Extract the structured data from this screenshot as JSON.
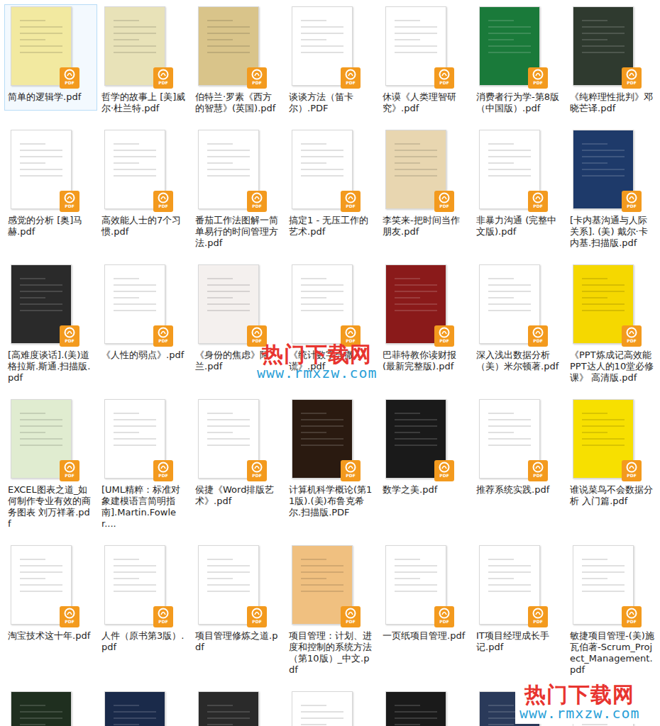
{
  "badge": "PDF",
  "files": [
    {
      "label": "简单的逻辑学.pdf",
      "selected": true,
      "color": "#f2e9a0"
    },
    {
      "label": "哲学的故事上 [美]威尔·杜兰特.pdf",
      "selected": false,
      "color": "#e8e2b8"
    },
    {
      "label": "伯特兰·罗素《西方的智慧》(英国).pdf",
      "selected": false,
      "color": "#d9c48a"
    },
    {
      "label": "谈谈方法（笛卡尔）.PDF",
      "selected": false,
      "color": "#ffffff"
    },
    {
      "label": "休谟《人类理智研究》.pdf",
      "selected": false,
      "color": "#ffffff"
    },
    {
      "label": "消费者行为学-第8版（中国版）.pdf",
      "selected": false,
      "color": "#1a7a3a"
    },
    {
      "label": "《纯粹理性批判》邓晓芒译.pdf",
      "selected": false,
      "color": "#2f3a2f"
    },
    {
      "label": "感觉的分析 [奥]马赫.pdf",
      "selected": false,
      "color": "#ffffff"
    },
    {
      "label": "高效能人士的7个习惯.pdf",
      "selected": false,
      "color": "#ffffff"
    },
    {
      "label": "番茄工作法图解一简单易行的时间管理方法.pdf",
      "selected": false,
      "color": "#ffffff"
    },
    {
      "label": "搞定1 - 无压工作的艺术.pdf",
      "selected": false,
      "color": "#ffffff"
    },
    {
      "label": "李笑来-把时间当作朋友.pdf",
      "selected": false,
      "color": "#e8d6b0"
    },
    {
      "label": "非暴力沟通 (完整中文版).pdf",
      "selected": false,
      "color": "#ffffff"
    },
    {
      "label": "[卡内基沟通与人际关系]. (美) 戴尔·卡内基.扫描版.pdf",
      "selected": false,
      "color": "#1e3a6a"
    },
    {
      "label": "[高难度谈话].(美)道格拉斯.斯通.扫描版.pdf",
      "selected": false,
      "color": "#2a2a2a"
    },
    {
      "label": "《人性的弱点》.pdf",
      "selected": false,
      "color": "#ffffff"
    },
    {
      "label": "《身份的焦虑》阿兰.pdf",
      "selected": false,
      "color": "#f4f0ee"
    },
    {
      "label": "《统计数字会撒谎》.pdf",
      "selected": false,
      "color": "#ffffff"
    },
    {
      "label": "巴菲特教你读财报(最新完整版).pdf",
      "selected": false,
      "color": "#8a1a1a"
    },
    {
      "label": "深入浅出数据分析（美）米尔顿著.pdf",
      "selected": false,
      "color": "#ffffff"
    },
    {
      "label": "《PPT炼成记高效能PPT达人的10堂必修课》 高清版.pdf",
      "selected": false,
      "color": "#f5d800"
    },
    {
      "label": "EXCEL图表之道_如何制作专业有效的商务图表 刘万祥著.pdf",
      "selected": false,
      "color": "#e0ecd0"
    },
    {
      "label": "[UML精粹：标准对象建模语言简明指南].Martin.Fowler....",
      "selected": false,
      "color": "#ffffff"
    },
    {
      "label": "侯捷《Word排版艺术》.pdf",
      "selected": false,
      "color": "#ffffff"
    },
    {
      "label": "计算机科学概论(第11版).(美)布鲁克希尔.扫描版.PDF",
      "selected": false,
      "color": "#2a1a10"
    },
    {
      "label": "数学之美.pdf",
      "selected": false,
      "color": "#1a1a1a"
    },
    {
      "label": "推荐系统实践.pdf",
      "selected": false,
      "color": "#ffffff"
    },
    {
      "label": "谁说菜鸟不会数据分析 入门篇.pdf",
      "selected": false,
      "color": "#f7e000"
    },
    {
      "label": "淘宝技术这十年.pdf",
      "selected": false,
      "color": "#ffffff"
    },
    {
      "label": "人件（原书第3版）.pdf",
      "selected": false,
      "color": "#ffffff"
    },
    {
      "label": "项目管理修炼之道.pdf",
      "selected": false,
      "color": "#ffffff"
    },
    {
      "label": "项目管理：计划、进度和控制的系统方法（第10版）_中文.pdf",
      "selected": false,
      "color": "#f0c080"
    },
    {
      "label": "一页纸项目管理.pdf",
      "selected": false,
      "color": "#ffffff"
    },
    {
      "label": "IT项目经理成长手记.pdf",
      "selected": false,
      "color": "#ffffff"
    },
    {
      "label": "敏捷项目管理-(美)施瓦伯著-Scrum_Project_Management.pdf",
      "selected": false,
      "color": "#ffffff"
    }
  ],
  "partial_row": [
    {
      "selected": false,
      "color": "#1f2f1f"
    },
    {
      "selected": false,
      "color": "#1a2a4a"
    },
    {
      "selected": false,
      "color": "#2a2a2a"
    },
    {
      "selected": false,
      "color": "#ffffff"
    },
    {
      "selected": false,
      "color": "#1a1a1a"
    },
    {
      "selected": false,
      "color": "#2a3a5a"
    },
    {
      "selected": false,
      "color": "#ffffff"
    }
  ],
  "watermarks": [
    {
      "site": "热门下载网",
      "url": "www.rmxzw.com"
    },
    {
      "site": "热门下载网",
      "url": "www.rmxzw.com"
    }
  ]
}
